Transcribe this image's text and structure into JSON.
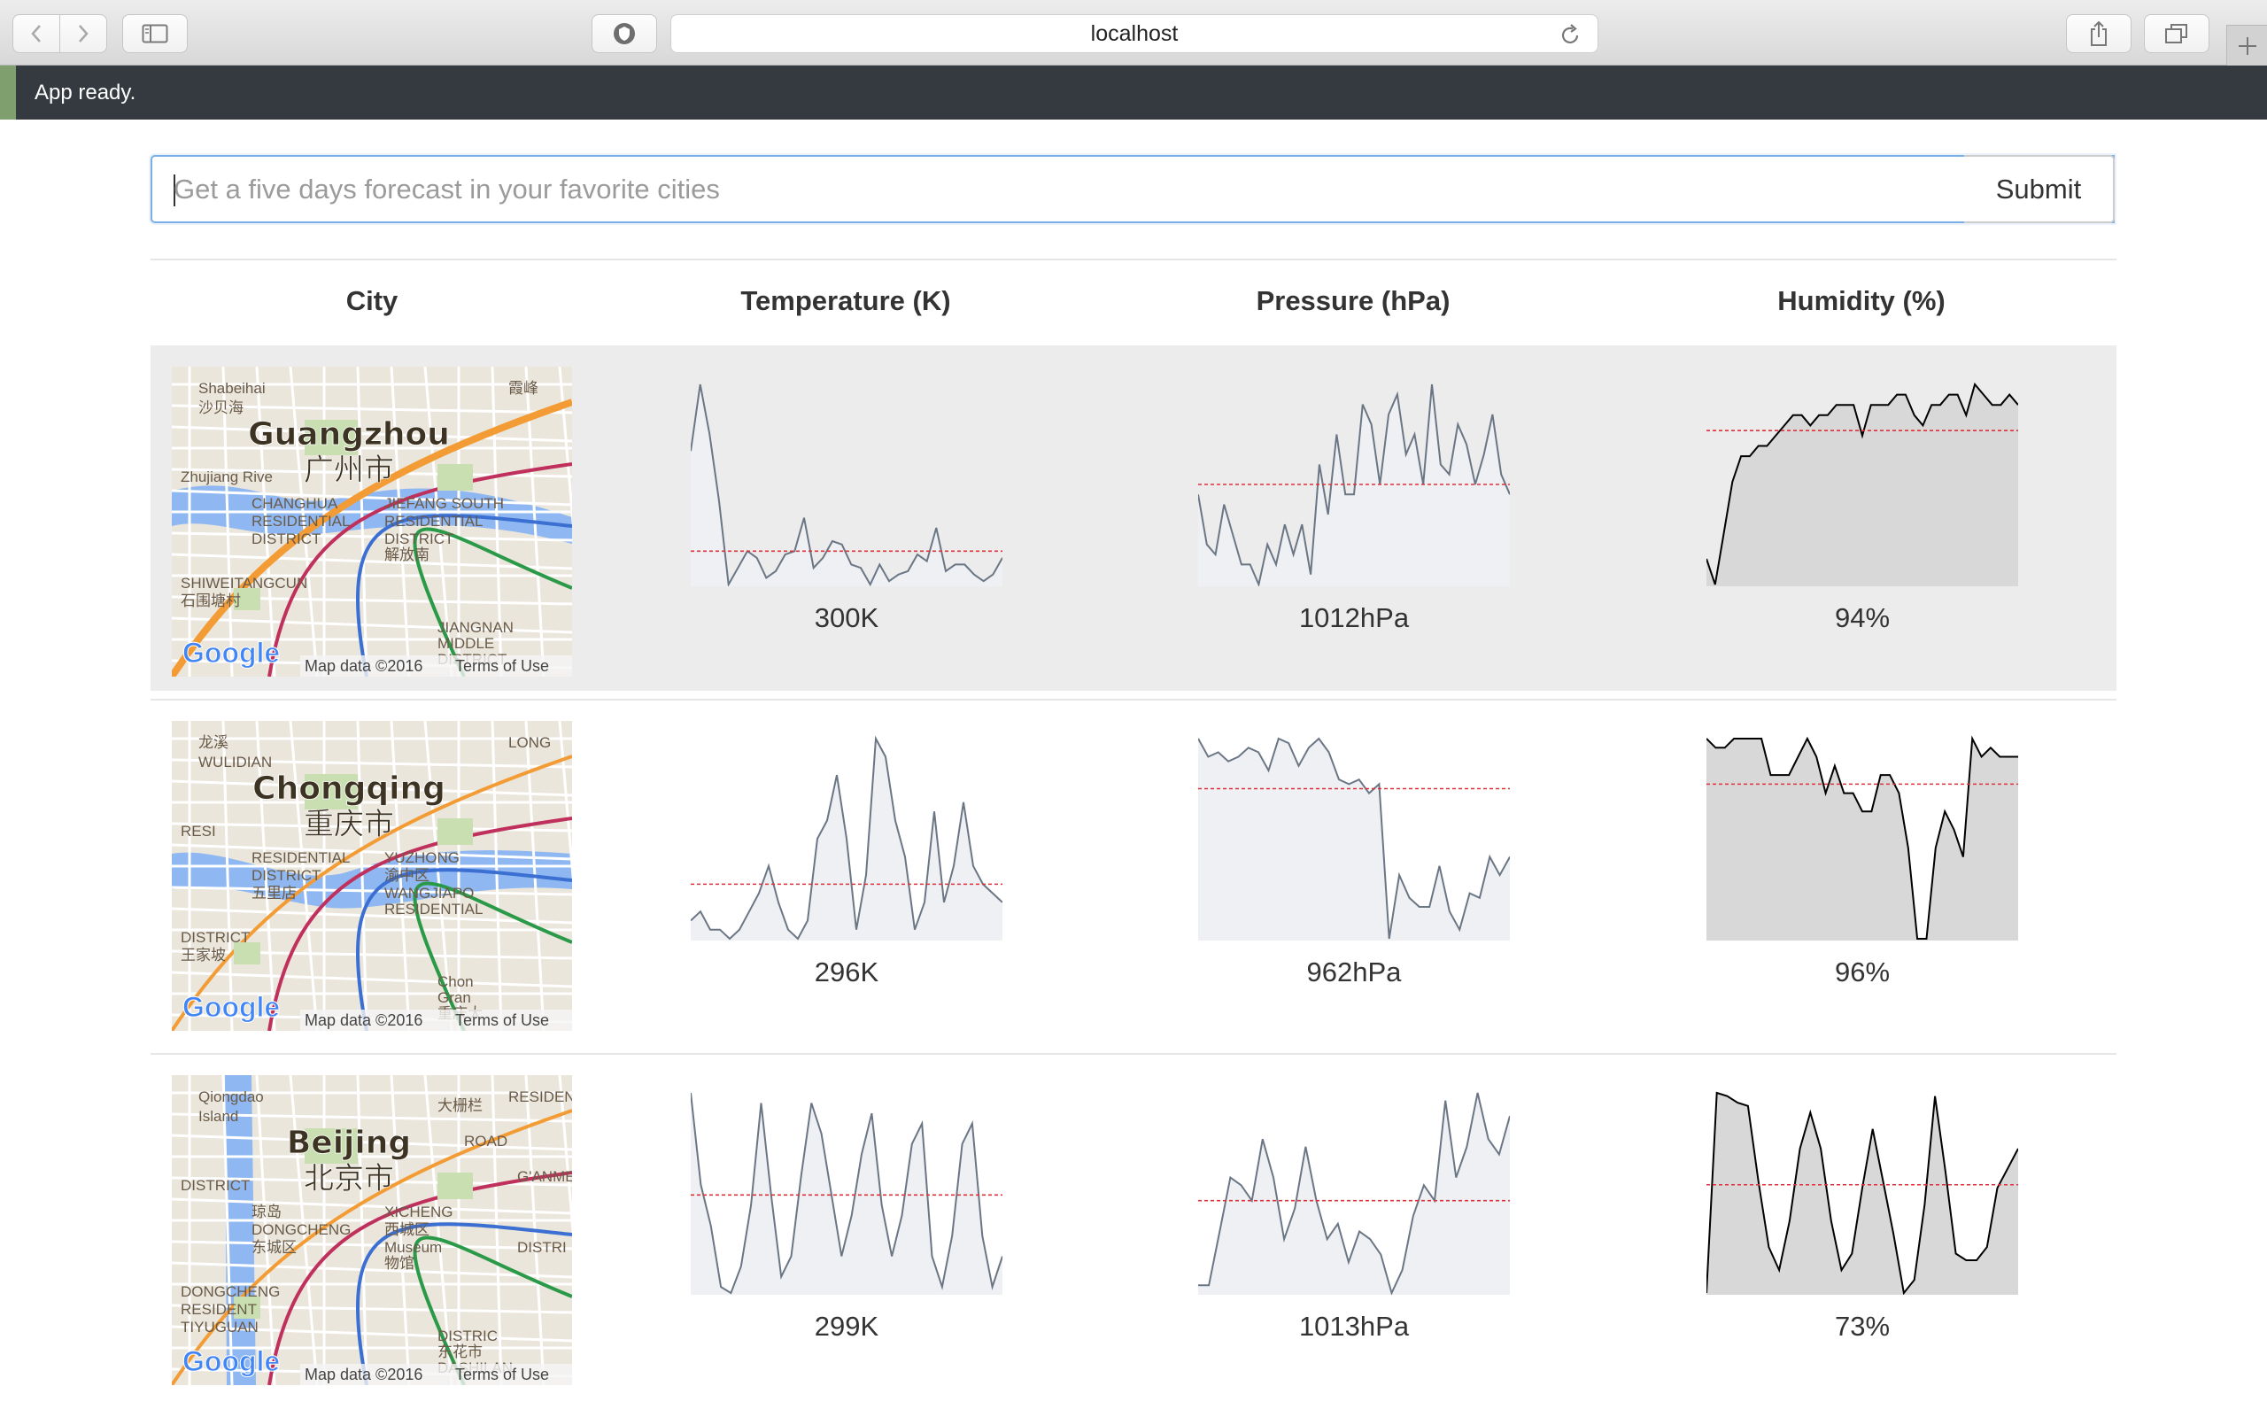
{
  "browser": {
    "url": "localhost"
  },
  "status": {
    "message": "App ready."
  },
  "search": {
    "placeholder": "Get a five days forecast in your favorite cities",
    "value": "",
    "submit_label": "Submit"
  },
  "table": {
    "headers": [
      "City",
      "Temperature (K)",
      "Pressure (hPa)",
      "Humidity (%)"
    ]
  },
  "cities": [
    {
      "name": "Guangzhou",
      "name_cn": "广州市",
      "map_labels": [
        "Shabeihai",
        "沙贝海",
        "CHANGHUA",
        "RESIDENTIAL",
        "DISTRICT",
        "JIEFANG SOUTH",
        "RESIDENTIAL",
        "DISTRICT",
        "解放南",
        "SHIWEITANGCUN",
        "石围塘村",
        "JIANGNAN",
        "MIDDLE",
        "DISTRICT",
        "霞峰",
        "Zhujiang Rive"
      ],
      "temperature": "300K",
      "pressure": "1012hPa",
      "humidity": "94%",
      "temp_series": [
        299,
        301,
        299.5,
        297.5,
        295,
        295.5,
        296,
        295.8,
        295.2,
        295.4,
        295.9,
        296,
        297,
        295.5,
        295.8,
        296.3,
        296.2,
        295.6,
        295.5,
        295,
        295.6,
        295.1,
        295.3,
        295.4,
        295.9,
        295.7,
        296.7,
        295.4,
        295.6,
        295.6,
        295.3,
        295.1,
        295.3,
        295.8
      ],
      "pres_series": [
        1011,
        1006,
        1005,
        1010,
        1007,
        1004,
        1004,
        1002,
        1006,
        1004,
        1008,
        1005,
        1008,
        1003,
        1014,
        1009,
        1017,
        1011,
        1011,
        1020,
        1018,
        1012,
        1019,
        1021,
        1015,
        1017,
        1012,
        1022,
        1014,
        1013,
        1018,
        1016,
        1012,
        1015,
        1019,
        1013,
        1011
      ],
      "hum_series": [
        60,
        55,
        65,
        75,
        80,
        80,
        82,
        82,
        84,
        86,
        88,
        88,
        86,
        88,
        88,
        90,
        90,
        90,
        84,
        90,
        90,
        90,
        92,
        92,
        88,
        86,
        90,
        90,
        92,
        92,
        88,
        94,
        92,
        90,
        90,
        92,
        90
      ],
      "temp_ref": 296,
      "pres_ref": 1012,
      "hum_ref": 85
    },
    {
      "name": "Chongqing",
      "name_cn": "重庆市",
      "map_labels": [
        "龙溪",
        "WULIDIAN",
        "RESIDENTIAL",
        "DISTRICT",
        "五里店",
        "YUZHONG",
        "渝中区",
        "WANGJIAPO",
        "RESIDENTIAL",
        "DISTRICT",
        "王家坡",
        "Chon",
        "Gran",
        "重庆大",
        "LONG",
        "RESI"
      ],
      "temperature": "296K",
      "pressure": "962hPa",
      "humidity": "96%",
      "temp_series": [
        292,
        292.5,
        291.5,
        291.5,
        291,
        291.5,
        292.5,
        293.5,
        295,
        293,
        291.5,
        291,
        292,
        296.5,
        297.5,
        300,
        296.5,
        291.5,
        294.5,
        302,
        301,
        297.5,
        295.5,
        291.5,
        293,
        298,
        293,
        295,
        298.5,
        295,
        294,
        293.5,
        293
      ],
      "pres_series": [
        1016,
        1012,
        1013,
        1011,
        1012,
        1014,
        1013,
        1009,
        1016,
        1015,
        1010,
        1014,
        1016,
        1013,
        1007,
        1006,
        1007,
        1004,
        1006,
        972,
        986,
        981,
        979,
        979,
        988,
        978,
        974,
        982,
        981,
        990,
        986,
        990
      ],
      "hum_series": [
        98,
        97,
        97,
        98,
        98,
        98,
        98,
        94,
        94,
        94,
        96,
        98,
        96,
        92,
        95,
        92,
        92,
        90,
        90,
        94,
        94,
        92,
        86,
        76,
        76,
        86,
        90,
        88,
        85,
        98,
        96,
        97,
        96,
        96,
        96
      ],
      "temp_ref": 294,
      "pres_ref": 1005,
      "hum_ref": 93
    },
    {
      "name": "Beijing",
      "name_cn": "北京市",
      "map_labels": [
        "Qiongdao",
        "Island",
        "琼岛",
        "DONGCHENG",
        "东城区",
        "XICHENG",
        "西城区",
        "Museum",
        "物馆",
        "DONGCHENG",
        "RESIDENT",
        "DISTRIC",
        "东花市",
        "DASHILAN",
        "RESIDENTIAL",
        "DISTRICT",
        "大栅栏",
        "TIYUGUAN",
        "ROAD",
        "G'ANMENNEI",
        "DISTRI"
      ],
      "temperature": "299K",
      "pressure": "1013hPa",
      "humidity": "73%",
      "temp_series": [
        303,
        298.5,
        296.5,
        293.5,
        293.2,
        294.5,
        297.5,
        302.5,
        298,
        294,
        295,
        299,
        302.5,
        301,
        298,
        295,
        297,
        300,
        302,
        297.5,
        295,
        297,
        300.5,
        301.5,
        295,
        293.5,
        296,
        300.5,
        301.5,
        296,
        293.5,
        295
      ],
      "pres_series": [
        1001,
        1001,
        1008,
        1015,
        1014,
        1012,
        1020,
        1015,
        1007,
        1011,
        1019,
        1012,
        1007,
        1009,
        1004,
        1008,
        1007,
        1005,
        1000,
        1003,
        1010,
        1014,
        1012,
        1025,
        1015,
        1019,
        1026,
        1020,
        1018,
        1023
      ],
      "hum_series": [
        38,
        99,
        98,
        96,
        95,
        72,
        52,
        45,
        60,
        82,
        93,
        82,
        60,
        45,
        50,
        70,
        88,
        72,
        56,
        38,
        42,
        65,
        98,
        75,
        50,
        48,
        48,
        52,
        70,
        76,
        82
      ],
      "temp_ref": 298,
      "pres_ref": 1012,
      "hum_ref": 71
    }
  ]
}
